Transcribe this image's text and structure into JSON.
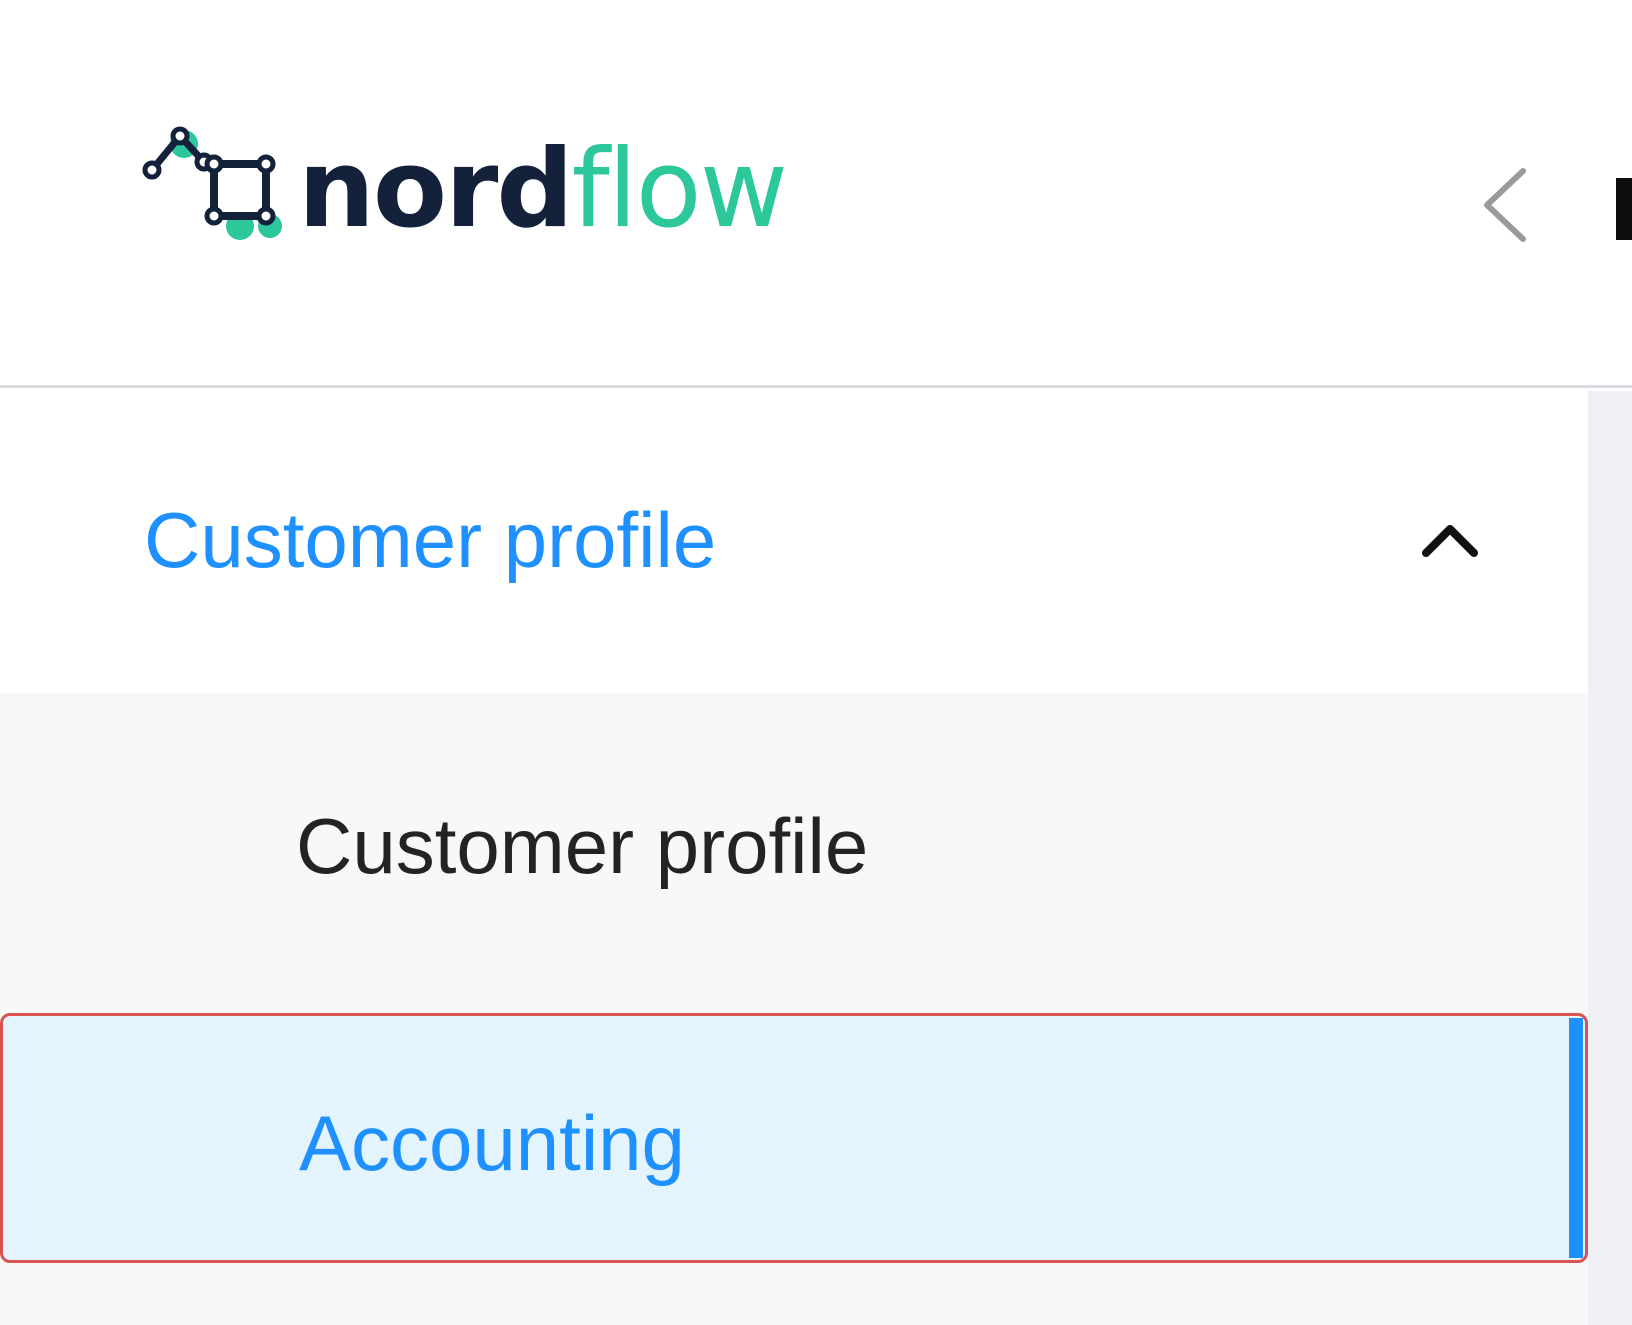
{
  "brand": {
    "name_primary": "nord",
    "name_secondary": "flow",
    "colors": {
      "primary": "#13213b",
      "accent": "#2cc79a",
      "link": "#1e90ff"
    }
  },
  "header": {
    "collapse_icon": "chevron-left-icon"
  },
  "sidebar": {
    "group": {
      "label": "Customer profile",
      "expanded": true,
      "toggle_icon": "chevron-up-icon"
    },
    "items": [
      {
        "label": "Customer profile",
        "active": false
      },
      {
        "label": "Accounting",
        "active": true
      }
    ]
  }
}
